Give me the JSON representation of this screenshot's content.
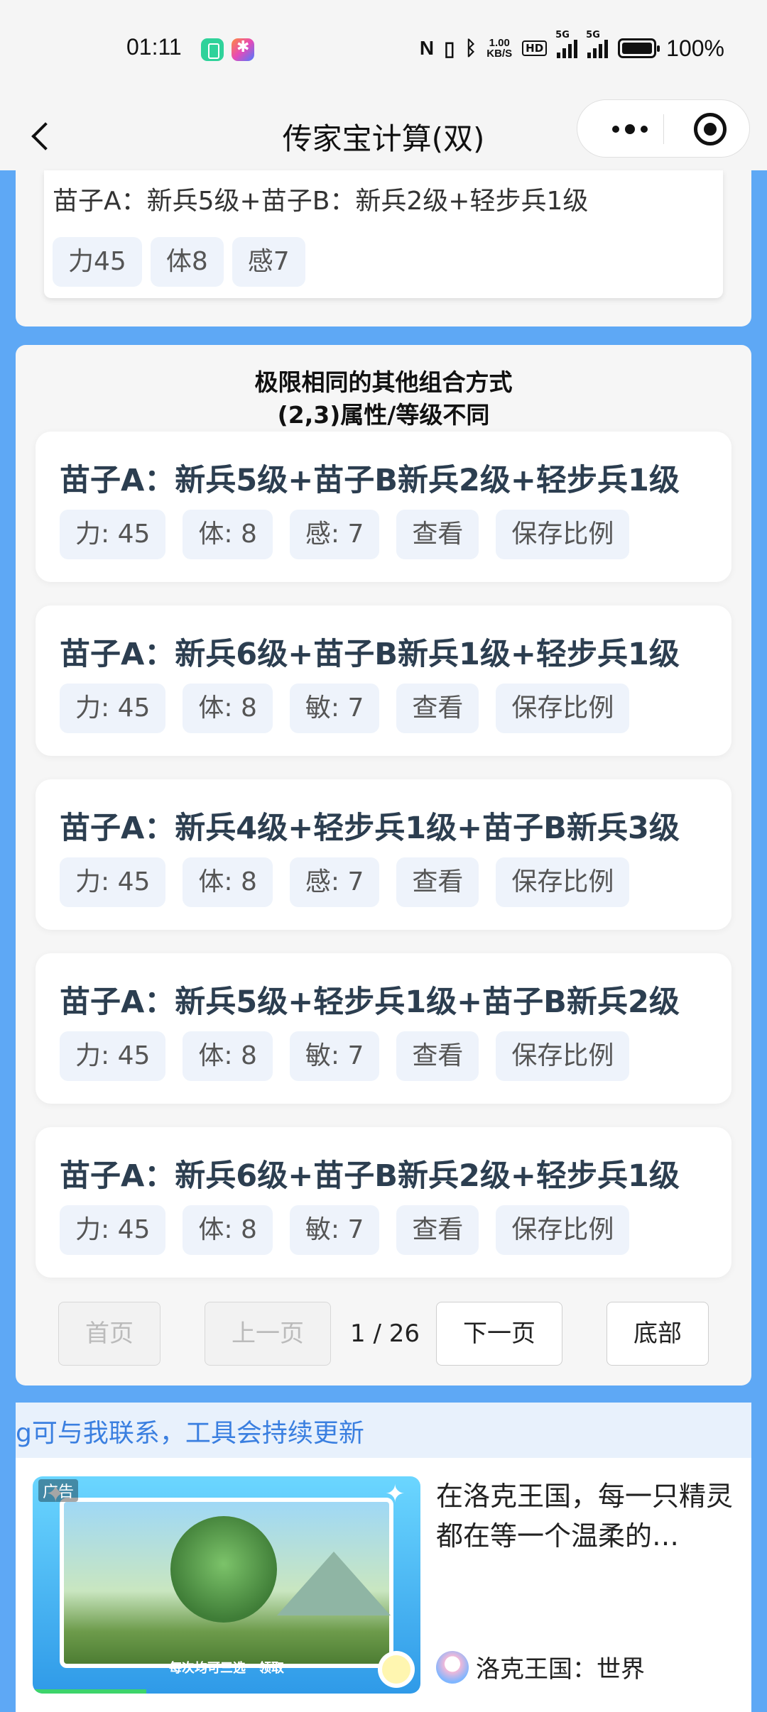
{
  "status_bar": {
    "time": "01:11",
    "speed_value": "1.00",
    "speed_unit": "KB/S",
    "hd": "HD",
    "sig1_label": "5G",
    "sig2_label": "5G",
    "battery": "100%"
  },
  "nav": {
    "title": "传家宝计算(双)"
  },
  "top_result": {
    "title": "苗子A：新兵5级+苗子B：新兵2级+轻步兵1级",
    "tags": [
      "力45",
      "体8",
      "感7"
    ]
  },
  "section": {
    "heading_line1": "极限相同的其他组合方式",
    "heading_line2": "(2,3)属性/等级不同"
  },
  "combos": [
    {
      "title": "苗子A：新兵5级+苗子B新兵2级+轻步兵1级",
      "str": "力: 45",
      "con": "体: 8",
      "third": "感: 7",
      "view": "查看",
      "save": "保存比例"
    },
    {
      "title": "苗子A：新兵6级+苗子B新兵1级+轻步兵1级",
      "str": "力: 45",
      "con": "体: 8",
      "third": "敏: 7",
      "view": "查看",
      "save": "保存比例"
    },
    {
      "title": "苗子A：新兵4级+轻步兵1级+苗子B新兵3级",
      "str": "力: 45",
      "con": "体: 8",
      "third": "感: 7",
      "view": "查看",
      "save": "保存比例"
    },
    {
      "title": "苗子A：新兵5级+轻步兵1级+苗子B新兵2级",
      "str": "力: 45",
      "con": "体: 8",
      "third": "敏: 7",
      "view": "查看",
      "save": "保存比例"
    },
    {
      "title": "苗子A：新兵6级+苗子B新兵2级+轻步兵1级",
      "str": "力: 45",
      "con": "体: 8",
      "third": "敏: 7",
      "view": "查看",
      "save": "保存比例"
    }
  ],
  "pager": {
    "first": "首页",
    "prev": "上一页",
    "page": "1 / 26",
    "next": "下一页",
    "bottom": "底部"
  },
  "notice": {
    "text": "g可与我联系，工具会持续更新"
  },
  "ad": {
    "badge": "广告",
    "caption": "每次均可三选一领取",
    "description": "在洛克王国，每一只精灵都在等一个温柔的…",
    "source": "洛克王国：世界"
  }
}
